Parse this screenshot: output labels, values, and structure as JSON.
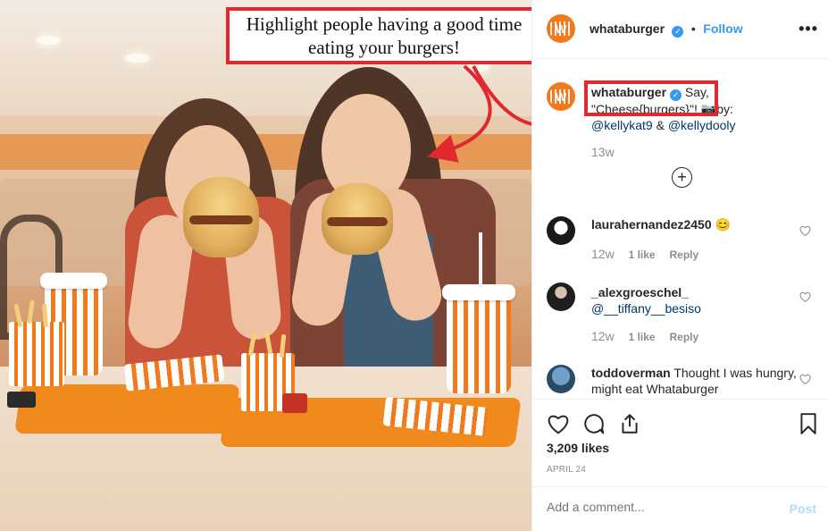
{
  "callout": {
    "text": "Highlight people having a good time\neating your burgers!"
  },
  "header": {
    "username": "whataburger",
    "verified_icon": "verified-check-icon",
    "separator": "•",
    "follow_label": "Follow",
    "more_icon": "more-options-icon"
  },
  "caption": {
    "username": "whataburger",
    "text_before": "Say, \"Cheese{burgers}\"! ",
    "camera_emoji": "📷",
    "text_after": "by: ",
    "mention1": "@kellykat9",
    "and": " & ",
    "mention2": "@kellydooly",
    "time": "13w",
    "load_more_icon": "plus-circle-icon"
  },
  "comments": [
    {
      "username": "laurahernandez2450",
      "text": "😊",
      "time": "12w",
      "likes": "1 like",
      "reply": "Reply"
    },
    {
      "username": "_alexgroeschel_",
      "text": "@__tiffany__besiso",
      "time": "12w",
      "likes": "1 like",
      "reply": "Reply"
    },
    {
      "username": "toddoverman",
      "text": "Thought I was hungry, might eat Whataburger"
    }
  ],
  "actions": {
    "like_icon": "heart-icon",
    "comment_icon": "comment-icon",
    "share_icon": "share-icon",
    "save_icon": "bookmark-icon",
    "likes_count": "3,209 likes",
    "date": "APRIL 24"
  },
  "add_comment": {
    "placeholder": "Add a comment...",
    "post_label": "Post"
  },
  "colors": {
    "accent": "#3897f0",
    "callout_border": "#e0282e",
    "brand_orange": "#f07a1d"
  }
}
